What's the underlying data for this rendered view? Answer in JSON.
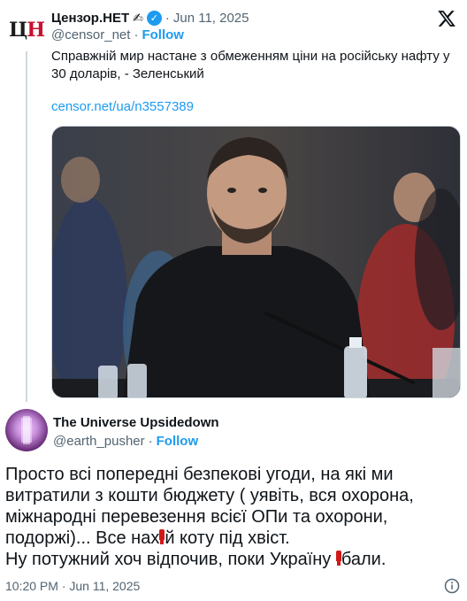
{
  "quoted_tweet": {
    "avatar_text_1": "Ц",
    "avatar_text_2": "Н",
    "display_name": "Цензор.НЕТ",
    "name_emoji": "✍",
    "date": "Jun 11, 2025",
    "handle": "@censor_net",
    "follow_label": "Follow",
    "text": "Справжній мир настане з обмеженням ціни на російську нафту у 30 доларів, - Зеленський",
    "link": "censor.net/ua/n3557389"
  },
  "reply": {
    "display_name": "The Universe Upsidedown",
    "handle": "@earth_pusher",
    "follow_label": "Follow",
    "lines": [
      "Просто всі попередні безпекові угоди, на які ми",
      "витратили з кошти бюджету ( уявіть, вся охорона,",
      "міжнародні перевезення всієї ОПи та охорони,",
      "подоржі)... Все нах",
      "й коту під хвіст.",
      "Ну потужний хоч відпочив, поки Україну ",
      "бали."
    ],
    "timestamp": "10:20 PM · Jun 11, 2025"
  },
  "colors": {
    "accent": "#1d9bf0",
    "text": "#0f1419",
    "muted": "#536471",
    "censor_mark": "#d01818"
  }
}
